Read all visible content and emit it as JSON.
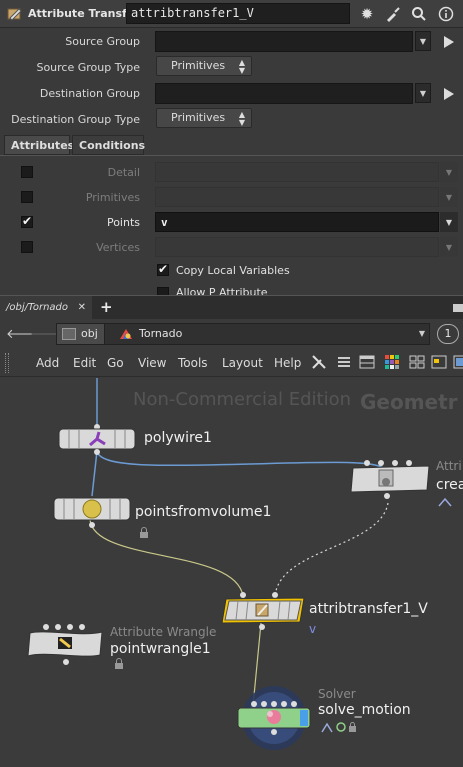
{
  "param_pane": {
    "node_type": "Attribute Transfer",
    "node_name": "attribtransfer1_V",
    "toolbar_icons": [
      "gear-icon",
      "broom-icon",
      "search-icon",
      "info-icon"
    ],
    "rows": {
      "source_group": {
        "label": "Source Group",
        "value": ""
      },
      "source_group_type": {
        "label": "Source Group Type",
        "value": "Primitives"
      },
      "destination_group": {
        "label": "Destination Group",
        "value": ""
      },
      "destination_group_type": {
        "label": "Destination Group Type",
        "value": "Primitives"
      }
    },
    "tabs": [
      {
        "label": "Attributes",
        "active": true
      },
      {
        "label": "Conditions",
        "active": false
      }
    ],
    "attributes": [
      {
        "label": "Detail",
        "checked": false,
        "value": ""
      },
      {
        "label": "Primitives",
        "checked": false,
        "value": ""
      },
      {
        "label": "Points",
        "checked": true,
        "value": "v"
      },
      {
        "label": "Vertices",
        "checked": false,
        "value": ""
      }
    ],
    "copy_local_variables": {
      "label": "Copy Local Variables",
      "checked": true
    },
    "truncated_option": {
      "label": "Allow P Attribute",
      "checked": false
    }
  },
  "network_pane": {
    "tab_label": "/obj/Tornado",
    "path": {
      "root": "obj",
      "current": "Tornado"
    },
    "pin_label": "1",
    "menu": [
      "Add",
      "Edit",
      "Go",
      "View",
      "Tools",
      "Layout",
      "Help"
    ],
    "watermark": "Non-Commercial Edition",
    "context_label": "Geometr",
    "nodes": {
      "polywire": {
        "name": "polywire1"
      },
      "create": {
        "type": "Attri",
        "name": "crea"
      },
      "pointsfromvolume": {
        "name": "pointsfromvolume1"
      },
      "attribtransfer": {
        "name": "attribtransfer1_V",
        "flag": "v"
      },
      "pointwrangle": {
        "type": "Attribute Wrangle",
        "name": "pointwrangle1"
      },
      "solver": {
        "type": "Solver",
        "name": "solve_motion"
      }
    },
    "colors": {
      "selected_outline": "#f2c200",
      "solver_node": "#8fd08a",
      "wire_blue": "#6b9bd2",
      "wire_yellow": "#c9c88a"
    }
  }
}
